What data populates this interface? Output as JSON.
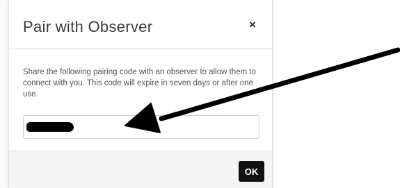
{
  "dialog": {
    "title": "Pair with Observer",
    "close_label": "×",
    "instructions": "Share the following pairing code with an observer to allow them to connect with you. This code will expire in seven days or after one use.",
    "code_field": {
      "value": "",
      "redacted": true
    },
    "ok_label": "OK"
  },
  "annotation": {
    "type": "arrow",
    "color": "#000000",
    "points_to": "pairing-code-field"
  },
  "colors": {
    "ok_button": "#111111",
    "footer": "#f5f5f5",
    "border": "#dedede",
    "body_text": "#555555"
  }
}
